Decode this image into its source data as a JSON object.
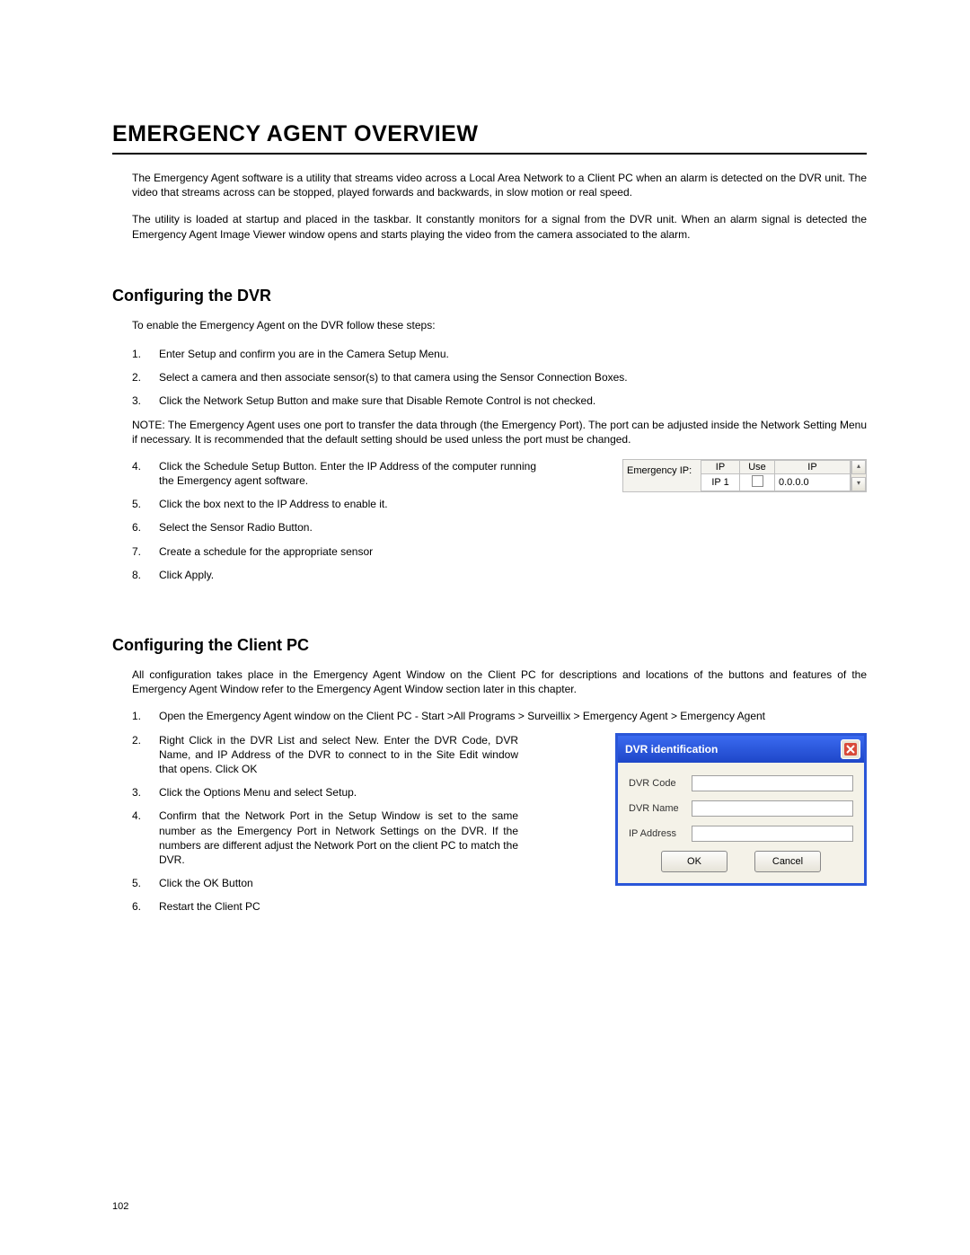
{
  "title": "EMERGENCY AGENT OVERVIEW",
  "intro": {
    "p1": "The Emergency Agent software is a utility that streams video across a Local Area Network to a Client PC when an alarm is detected on the DVR unit. The video that streams across can be stopped, played forwards and backwards, in slow motion or real speed.",
    "p2": "The utility is loaded at startup and placed in the taskbar. It constantly monitors for a signal from the DVR unit. When an alarm signal is detected the Emergency Agent Image Viewer window opens and starts playing the video from the camera associated to the alarm."
  },
  "section1": {
    "heading": "Configuring the DVR",
    "lead": "To enable the Emergency Agent on the DVR follow these steps:",
    "s1": "Enter Setup and confirm you are in the Camera Setup Menu.",
    "s2": "Select a camera and then associate sensor(s) to that camera using the Sensor Connection Boxes.",
    "s3": "Click the Network Setup Button and make sure that Disable Remote Control is not checked.",
    "note": "NOTE: The Emergency Agent uses one port to transfer the data through (the Emergency Port). The port can be adjusted inside the Network Setting Menu if necessary. It is recommended that the default setting should be used unless the port must be changed.",
    "s4": "Click the Schedule Setup Button.  Enter the IP Address of the computer running the Emergency agent software.",
    "s5": "Click the box next to the IP Address to enable it.",
    "s6": "Select the Sensor Radio Button.",
    "s7": "Create a schedule for the appropriate sensor",
    "s8": "Click Apply."
  },
  "emergency_ip_table": {
    "label": "Emergency IP:",
    "headers": {
      "c1": "IP",
      "c2": "Use",
      "c3": "IP"
    },
    "row": {
      "name": "IP 1",
      "ip": "0.0.0.0"
    }
  },
  "section2": {
    "heading": "Configuring the Client PC",
    "lead": "All configuration takes place in the Emergency Agent Window on the Client PC for descriptions and locations of the buttons and features of the Emergency Agent Window refer to the Emergency Agent Window section later in this chapter.",
    "s1": "Open the Emergency Agent window on the Client PC - Start >All Programs > Surveillix > Emergency Agent > Emergency Agent",
    "s2": "Right Click in the DVR List and select New.  Enter the DVR Code, DVR Name, and IP Address of the DVR to connect to in the Site Edit window that opens. Click OK",
    "s3": "Click the Options Menu and select Setup.",
    "s4": "Confirm that the Network Port in the Setup Window is set to the same number as the Emergency Port in Network Settings on the DVR. If the numbers are different adjust the Network Port on the client PC to match the DVR.",
    "s5": "Click the OK Button",
    "s6": "Restart the Client PC"
  },
  "dialog": {
    "title": "DVR identification",
    "f1": "DVR Code",
    "f2": "DVR Name",
    "f3": "IP Address",
    "ok": "OK",
    "cancel": "Cancel"
  },
  "page_number": "102",
  "nums": {
    "n1": "1.",
    "n2": "2.",
    "n3": "3.",
    "n4": "4.",
    "n5": "5.",
    "n6": "6.",
    "n7": "7.",
    "n8": "8."
  }
}
